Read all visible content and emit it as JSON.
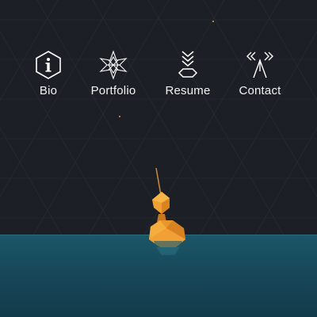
{
  "nav": {
    "items": [
      {
        "key": "bio",
        "label": "Bio",
        "icon": "info-hexagon-icon"
      },
      {
        "key": "portfolio",
        "label": "Portfolio",
        "icon": "star-flower-icon"
      },
      {
        "key": "resume",
        "label": "Resume",
        "icon": "chevron-stack-icon"
      },
      {
        "key": "contact",
        "label": "Contact",
        "icon": "antenna-signal-icon"
      }
    ]
  },
  "colors": {
    "background": "#1c1f25",
    "sea": "#1b5668",
    "accent": "#e8922a",
    "text": "#ffffff"
  }
}
